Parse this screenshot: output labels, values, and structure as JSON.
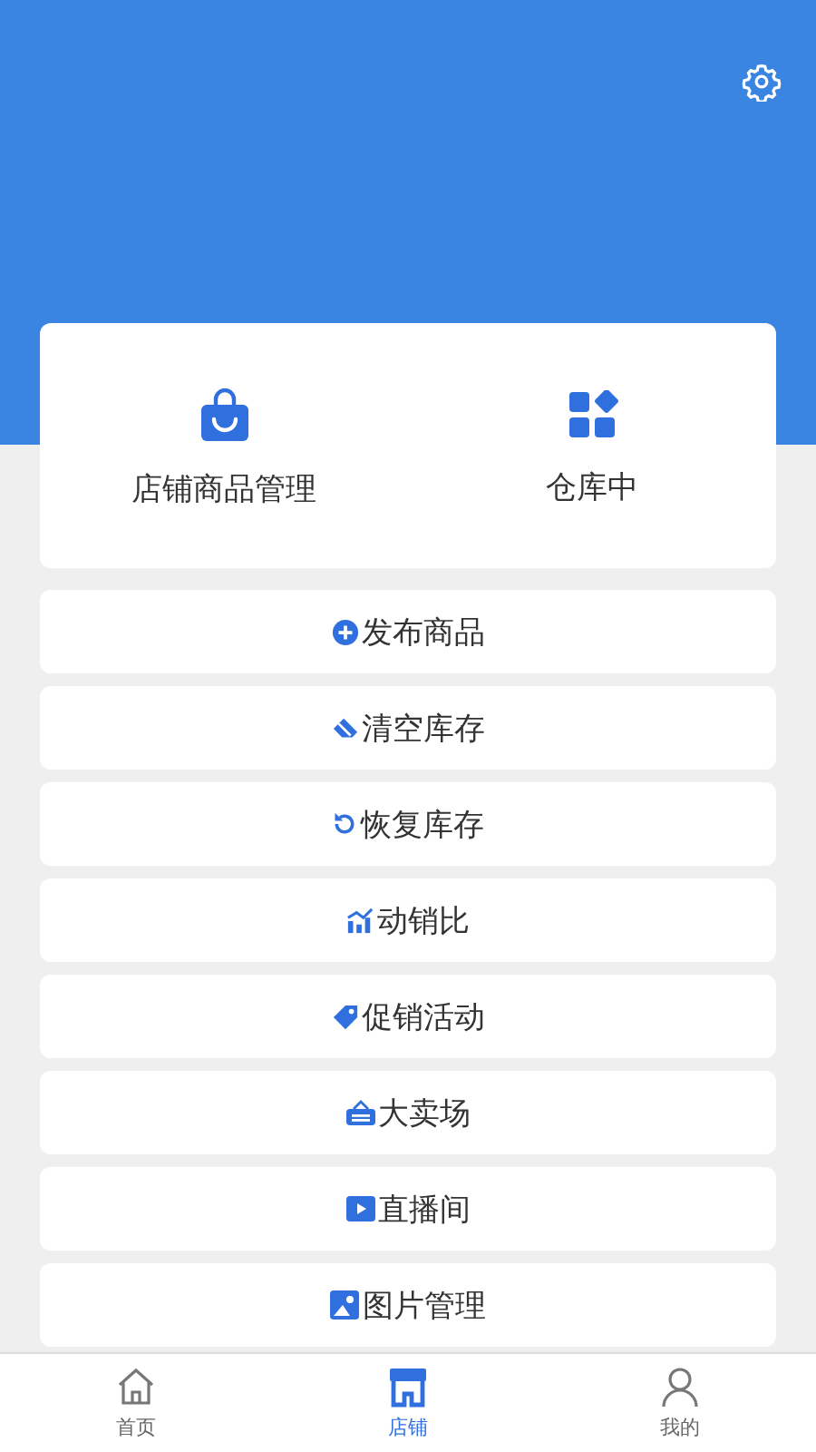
{
  "summary": [
    {
      "kind": "bag",
      "label": "店铺商品管理"
    },
    {
      "kind": "grid",
      "label": "仓库中"
    }
  ],
  "menu": [
    {
      "kind": "plus",
      "label": "发布商品"
    },
    {
      "kind": "eraser",
      "label": "清空库存"
    },
    {
      "kind": "undo",
      "label": "恢复库存"
    },
    {
      "kind": "chart",
      "label": "动销比"
    },
    {
      "kind": "tag",
      "label": "促销活动"
    },
    {
      "kind": "sale",
      "label": "大卖场"
    },
    {
      "kind": "play",
      "label": "直播间"
    },
    {
      "kind": "image",
      "label": "图片管理"
    }
  ],
  "tabbar": [
    {
      "kind": "home",
      "label": "首页",
      "selected": false
    },
    {
      "kind": "shop",
      "label": "店铺",
      "selected": true
    },
    {
      "kind": "user",
      "label": "我的",
      "selected": false
    }
  ]
}
